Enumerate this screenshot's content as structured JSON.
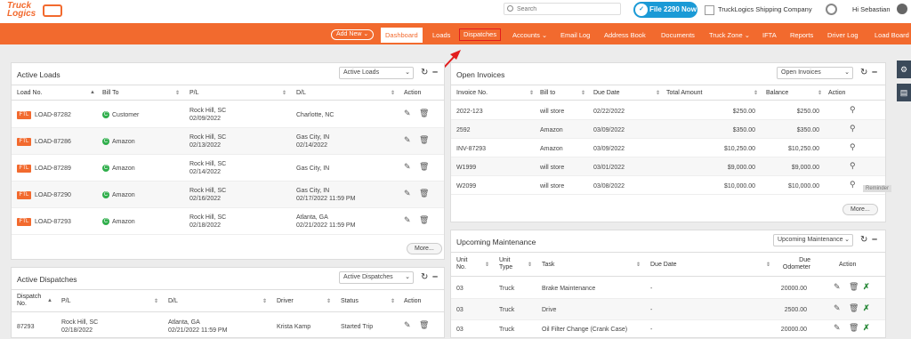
{
  "header": {
    "logo_text": "Truck Logics",
    "search_placeholder": "Search",
    "file2290_label": "File 2290 Now",
    "company_name": "TruckLogics Shipping Company",
    "greeting": "Hi Sebastian"
  },
  "nav": {
    "add_new": "Add New ⌄",
    "items": [
      "Dashboard",
      "Loads",
      "Dispatches",
      "Accounts ⌄",
      "Email Log",
      "Address Book",
      "Documents",
      "Truck Zone ⌄",
      "IFTA",
      "Reports",
      "Driver Log",
      "Load Board"
    ]
  },
  "active_loads": {
    "title": "Active Loads",
    "select": "Active Loads",
    "headers": [
      "Load No.",
      "Bill To",
      "P/L",
      "D/L",
      "Action"
    ],
    "rows": [
      {
        "badge": "FTL",
        "load": "LOAD-87282",
        "bill": "Customer",
        "pl": "Rock Hill, SC",
        "pl_date": "02/09/2022",
        "dl": "Charlotte, NC",
        "dl_date": ""
      },
      {
        "badge": "FTL",
        "load": "LOAD-87286",
        "bill": "Amazon",
        "pl": "Rock Hill, SC",
        "pl_date": "02/13/2022",
        "dl": "Gas City, IN",
        "dl_date": "02/14/2022"
      },
      {
        "badge": "FTL",
        "load": "LOAD-87289",
        "bill": "Amazon",
        "pl": "Rock Hill, SC",
        "pl_date": "02/14/2022",
        "dl": "Gas City, IN",
        "dl_date": ""
      },
      {
        "badge": "FTL",
        "load": "LOAD-87290",
        "bill": "Amazon",
        "pl": "Rock Hill, SC",
        "pl_date": "02/16/2022",
        "dl": "Gas City, IN",
        "dl_date": "02/17/2022 11:59 PM"
      },
      {
        "badge": "FTL",
        "load": "LOAD-87293",
        "bill": "Amazon",
        "pl": "Rock Hill, SC",
        "pl_date": "02/18/2022",
        "dl": "Atlanta, GA",
        "dl_date": "02/21/2022 11:59 PM"
      }
    ],
    "more": "More..."
  },
  "active_dispatches": {
    "title": "Active Dispatches",
    "select": "Active Dispatches",
    "headers": [
      "Dispatch No.",
      "P/L",
      "D/L",
      "Driver",
      "Status",
      "Action"
    ],
    "rows": [
      {
        "no": "87293",
        "pl": "Rock Hill, SC",
        "pl_date": "02/18/2022",
        "dl": "Atlanta, GA",
        "dl_date": "02/21/2022 11:59 PM",
        "driver": "Krista Kamp",
        "status": "Started Trip"
      }
    ]
  },
  "open_invoices": {
    "title": "Open Invoices",
    "select": "Open Invoices",
    "headers": [
      "Invoice No.",
      "Bill to",
      "Due Date",
      "Total Amount",
      "Balance",
      "Action"
    ],
    "rows": [
      {
        "no": "2022-123",
        "bill": "will store",
        "due": "02/22/2022",
        "total": "$250.00",
        "balance": "$250.00"
      },
      {
        "no": "2592",
        "bill": "Amazon",
        "due": "03/09/2022",
        "total": "$350.00",
        "balance": "$350.00"
      },
      {
        "no": "INV-87293",
        "bill": "Amazon",
        "due": "03/09/2022",
        "total": "$10,250.00",
        "balance": "$10,250.00"
      },
      {
        "no": "W1999",
        "bill": "will store",
        "due": "03/01/2022",
        "total": "$9,000.00",
        "balance": "$9,000.00"
      },
      {
        "no": "W2099",
        "bill": "will store",
        "due": "03/08/2022",
        "total": "$10,000.00",
        "balance": "$10,000.00"
      }
    ],
    "more": "More...",
    "tooltip": "Reminder"
  },
  "maintenance": {
    "title": "Upcoming Maintenance",
    "select": "Upcoming Maintenance",
    "headers": [
      "Unit No.",
      "Unit Type",
      "Task",
      "Due Date",
      "Due Odometer",
      "Action"
    ],
    "rows": [
      {
        "unit": "03",
        "type": "Truck",
        "task": "Brake Maintenance",
        "due": "-",
        "odo": "20000.00"
      },
      {
        "unit": "03",
        "type": "Truck",
        "task": "Drive",
        "due": "-",
        "odo": "2500.00"
      },
      {
        "unit": "03",
        "type": "Truck",
        "task": "Oil Filter Change (Crank Case)",
        "due": "-",
        "odo": "20000.00"
      }
    ]
  },
  "colors": {
    "brand": "#f26a2e",
    "arrow": "#e21d1d",
    "file2290": "#1b9ad6"
  }
}
